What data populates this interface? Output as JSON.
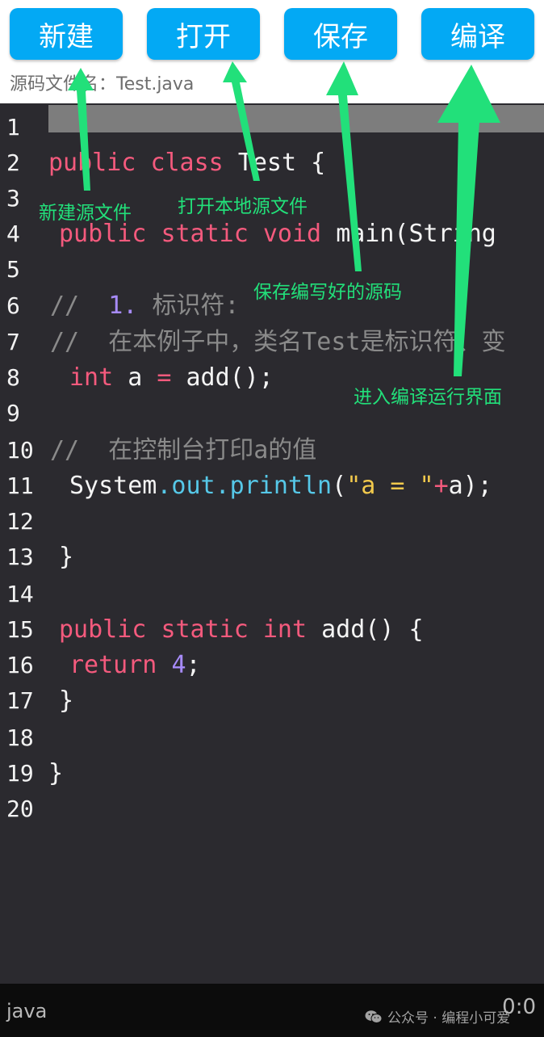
{
  "toolbar": {
    "new_label": "新建",
    "open_label": "打开",
    "save_label": "保存",
    "compile_label": "编译"
  },
  "file": {
    "filename_label": "源码文件名：Test.java"
  },
  "editor": {
    "line_numbers": [
      "1",
      "2",
      "3",
      "4",
      "5",
      "6",
      "7",
      "8",
      "9",
      "10",
      "11",
      "12",
      "13",
      "14",
      "15",
      "16",
      "17",
      "18",
      "19",
      "20"
    ],
    "code": {
      "l2_public": "public",
      "l2_class": "class",
      "l2_rest": "Test {",
      "l4_public": "public",
      "l4_static": "static",
      "l4_void": "void",
      "l4_rest": "main(String",
      "l6_comment": "//",
      "l6_num": "1.",
      "l6_text": "标识符:",
      "l7_comment": "//  在本例子中，类名Test是标识符、变",
      "l8_int": "int",
      "l8_a": "a",
      "l8_eq": "=",
      "l8_rest": "add();",
      "l10_comment": "//  在控制台打印a的值",
      "l11_system": "System",
      "l11_out": ".out.println",
      "l11_paren": "(",
      "l11_str": "\"a = \"",
      "l11_plus": "+",
      "l11_rest": "a);",
      "l13_brace": "}",
      "l15_public": "public",
      "l15_static": "static",
      "l15_int": "int",
      "l15_rest": "add() {",
      "l16_return": "return",
      "l16_num": "4",
      "l16_semi": ";",
      "l17_brace": "}",
      "l19_brace": "}"
    }
  },
  "status": {
    "language": "java",
    "cursor_position": "0:0",
    "watermark": "公众号 · 编程小可爱"
  },
  "annotations": {
    "new": "新建源文件",
    "open": "打开本地源文件",
    "save": "保存编写好的源码",
    "compile": "进入编译运行界面"
  },
  "colors": {
    "button_bg": "#03a9f4",
    "editor_bg": "#2b2a2f",
    "keyword": "#f45a7d",
    "number": "#a78bfa",
    "comment": "#8a8a8a",
    "string": "#f2c94c",
    "method": "#56c8e8",
    "annotation_green": "#22e07a"
  },
  "icons": {
    "watermark_logo": "wechat-icon"
  }
}
